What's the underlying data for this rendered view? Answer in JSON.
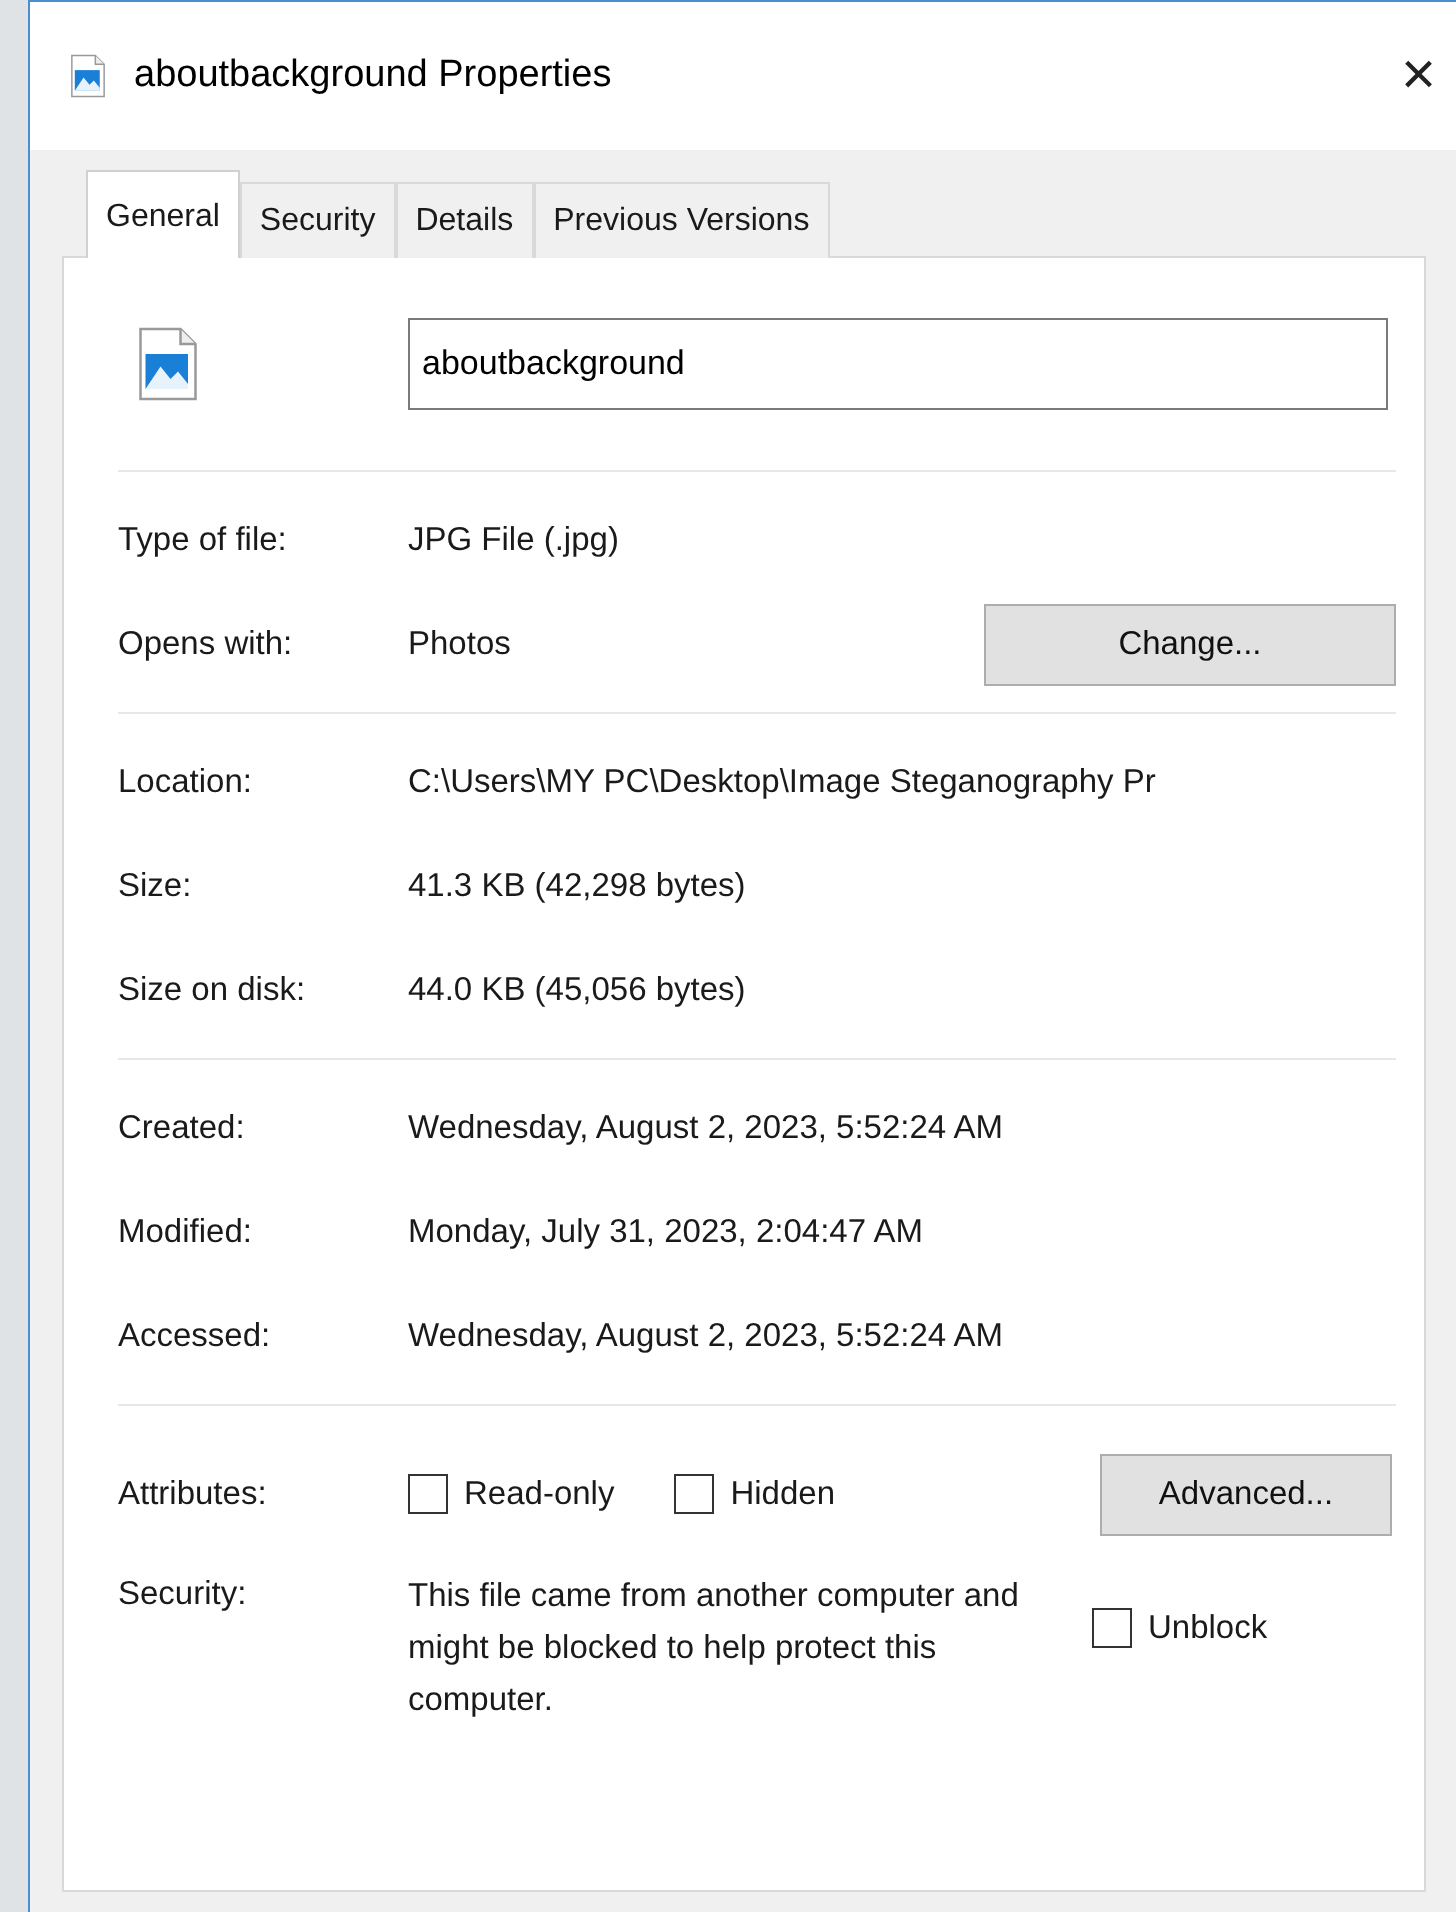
{
  "window": {
    "title": "aboutbackground Properties",
    "close": "×"
  },
  "tabs": [
    {
      "label": "General",
      "selected": true
    },
    {
      "label": "Security",
      "selected": false
    },
    {
      "label": "Details",
      "selected": false
    },
    {
      "label": "Previous Versions",
      "selected": false
    }
  ],
  "file_name": "aboutbackground",
  "sections": [
    [
      {
        "label": "Type of file:",
        "value": "JPG File (.jpg)"
      },
      {
        "label": "Opens with:",
        "value": "Photos",
        "button": "Change..."
      }
    ],
    [
      {
        "label": "Location:",
        "value": "C:\\Users\\MY PC\\Desktop\\Image Steganography Pr"
      },
      {
        "label": "Size:",
        "value": "41.3 KB (42,298 bytes)"
      },
      {
        "label": "Size on disk:",
        "value": "44.0 KB (45,056 bytes)"
      }
    ],
    [
      {
        "label": "Created:",
        "value": "Wednesday, August 2, 2023, 5:52:24 AM"
      },
      {
        "label": "Modified:",
        "value": "Monday, July 31, 2023, 2:04:47 AM"
      },
      {
        "label": "Accessed:",
        "value": "Wednesday, August 2, 2023, 5:52:24 AM"
      }
    ]
  ],
  "attributes": {
    "label": "Attributes:",
    "checkboxes": [
      {
        "label": "Read-only",
        "checked": false
      },
      {
        "label": "Hidden",
        "checked": false
      }
    ],
    "button": "Advanced..."
  },
  "security": {
    "label": "Security:",
    "text": "This file came from another computer and might be blocked to help protect this computer.",
    "checkbox": {
      "label": "Unblock",
      "checked": false
    }
  }
}
